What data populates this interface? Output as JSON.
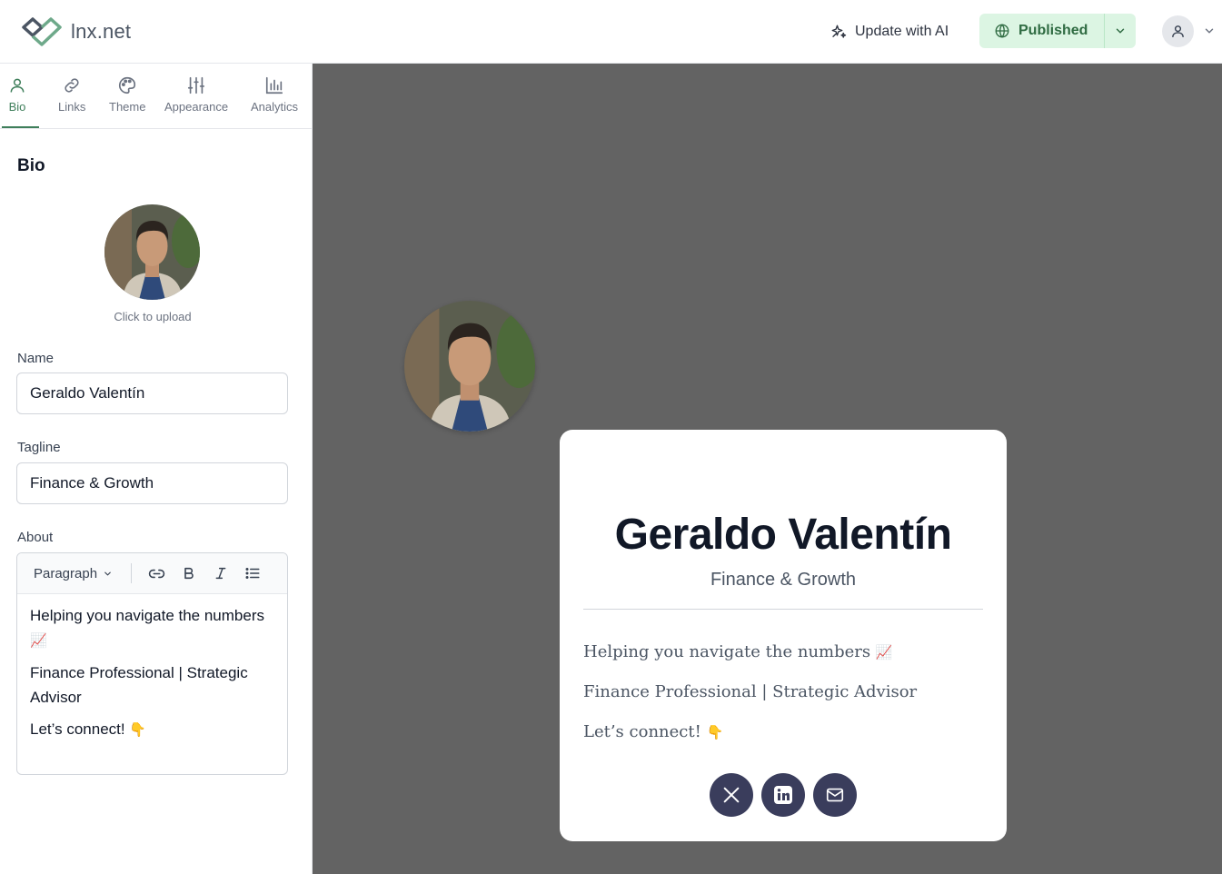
{
  "header": {
    "logo_text": "lnx.net",
    "ai_button_label": "Update with AI",
    "publish_label": "Published"
  },
  "tabs": [
    {
      "label": "Bio",
      "icon": "user-icon",
      "active": true
    },
    {
      "label": "Links",
      "icon": "link-icon"
    },
    {
      "label": "Theme",
      "icon": "palette-icon"
    },
    {
      "label": "Appearance",
      "icon": "sliders-icon"
    },
    {
      "label": "Analytics",
      "icon": "bar-chart-icon"
    }
  ],
  "bio": {
    "section_title": "Bio",
    "upload_label": "Click to upload",
    "name_label": "Name",
    "name_value": "Geraldo Valentín",
    "tagline_label": "Tagline",
    "tagline_value": "Finance & Growth",
    "about_label": "About",
    "toolbar": {
      "format_select": "Paragraph"
    },
    "about_lines": [
      {
        "text": "Helping you navigate the numbers",
        "emoji": "📈"
      },
      {
        "text": "Finance Professional | Strategic Advisor",
        "emoji": ""
      },
      {
        "text": "Let’s connect!",
        "emoji": "👇"
      }
    ]
  },
  "preview": {
    "name": "Geraldo Valentín",
    "tagline": "Finance & Growth",
    "about_lines": [
      {
        "text": "Helping you navigate the numbers",
        "emoji": "📈"
      },
      {
        "text": "Finance Professional | Strategic Advisor",
        "emoji": ""
      },
      {
        "text": "Let’s connect!",
        "emoji": "👇"
      }
    ],
    "socials": [
      {
        "icon": "x-twitter-icon"
      },
      {
        "icon": "linkedin-icon"
      },
      {
        "icon": "mail-icon"
      }
    ]
  },
  "colors": {
    "accent": "#3f7f5b",
    "published_bg": "#dcf5e3",
    "preview_bg": "#636363",
    "social_bg": "#3a3d5c"
  }
}
